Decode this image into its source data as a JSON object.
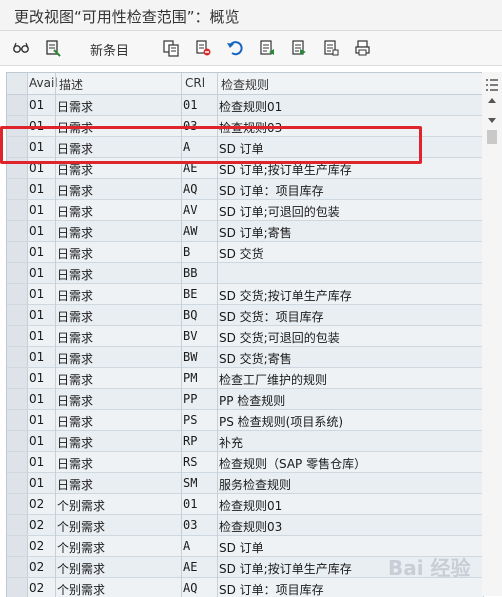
{
  "window": {
    "title": "更改视图“可用性检查范围”：概览"
  },
  "toolbar": {
    "new_entries_label": "新条目"
  },
  "grid": {
    "columns": [
      "Avail",
      "描述",
      "CRl",
      "检查规则"
    ],
    "rows": [
      [
        "01",
        "日需求",
        "01",
        "检查规则01"
      ],
      [
        "01",
        "日需求",
        "03",
        "检查规则03"
      ],
      [
        "01",
        "日需求",
        "A",
        "SD 订单"
      ],
      [
        "01",
        "日需求",
        "AE",
        "SD 订单;按订单生产库存"
      ],
      [
        "01",
        "日需求",
        "AQ",
        "SD 订单：项目库存"
      ],
      [
        "01",
        "日需求",
        "AV",
        "SD 订单;可退回的包装"
      ],
      [
        "01",
        "日需求",
        "AW",
        "SD 订单;寄售"
      ],
      [
        "01",
        "日需求",
        "B",
        "SD 交货"
      ],
      [
        "01",
        "日需求",
        "BB",
        ""
      ],
      [
        "01",
        "日需求",
        "BE",
        "SD 交货;按订单生产库存"
      ],
      [
        "01",
        "日需求",
        "BQ",
        "SD 交货：项目库存"
      ],
      [
        "01",
        "日需求",
        "BV",
        "SD 交货;可退回的包装"
      ],
      [
        "01",
        "日需求",
        "BW",
        "SD 交货;寄售"
      ],
      [
        "01",
        "日需求",
        "PM",
        "检查工厂维护的规则"
      ],
      [
        "01",
        "日需求",
        "PP",
        "PP 检查规则"
      ],
      [
        "01",
        "日需求",
        "PS",
        "PS 检查规则(项目系统)"
      ],
      [
        "01",
        "日需求",
        "RP",
        "补充"
      ],
      [
        "01",
        "日需求",
        "RS",
        "检查规则（SAP 零售仓库）"
      ],
      [
        "01",
        "日需求",
        "SM",
        "服务检查规则"
      ],
      [
        "02",
        "个别需求",
        "01",
        "检查规则01"
      ],
      [
        "02",
        "个别需求",
        "03",
        "检查规则03"
      ],
      [
        "02",
        "个别需求",
        "A",
        "SD 订单"
      ],
      [
        "02",
        "个别需求",
        "AE",
        "SD 订单;按订单生产库存"
      ],
      [
        "02",
        "个别需求",
        "AQ",
        "SD 订单：项目库存"
      ]
    ]
  },
  "watermark": {
    "text": "Bai 经验"
  },
  "colors": {
    "highlight": "#e0242b",
    "header_bg": "#f0f3f5",
    "row_bg": "#e9eef2"
  }
}
